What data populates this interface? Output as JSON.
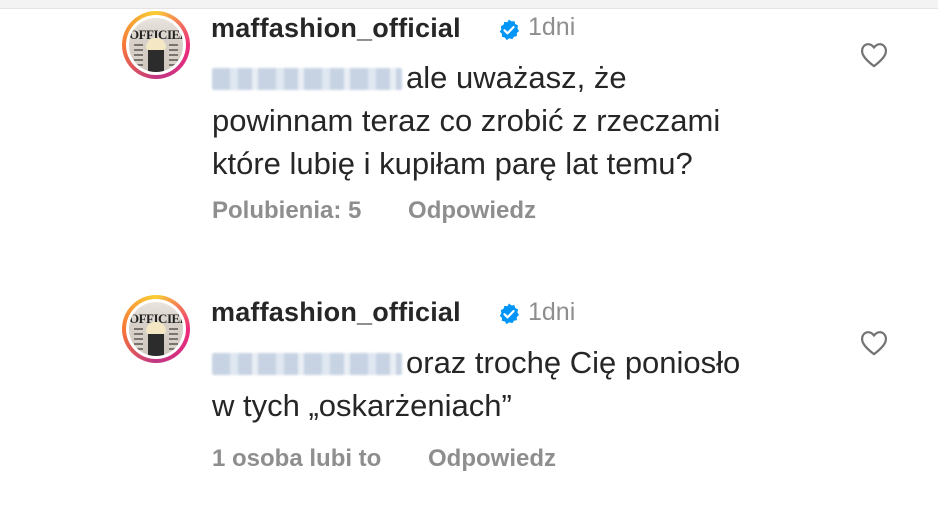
{
  "comments": [
    {
      "username": "maffashion_official",
      "time": "1dni",
      "avatar_text": "OFFICIEL",
      "text_lines": [
        "ale uważasz, że",
        "powinnam teraz co zrobić z rzeczami",
        "które lubię i kupiłam parę lat temu?"
      ],
      "likes": "Polubienia: 5",
      "reply": "Odpowiedz",
      "icons": {
        "verified": "verified-badge-icon",
        "heart": "heart-icon"
      }
    },
    {
      "username": "maffashion_official",
      "time": "1dni",
      "avatar_text": "OFFICIEL",
      "text_lines": [
        "oraz trochę Cię poniosło",
        "w tych „oskarżeniach”"
      ],
      "likes": "1 osoba lubi to",
      "reply": "Odpowiedz",
      "icons": {
        "verified": "verified-badge-icon",
        "heart": "heart-icon"
      }
    }
  ],
  "colors": {
    "text": "#262626",
    "secondary": "#8e8e8e",
    "verified": "#0095f6"
  }
}
